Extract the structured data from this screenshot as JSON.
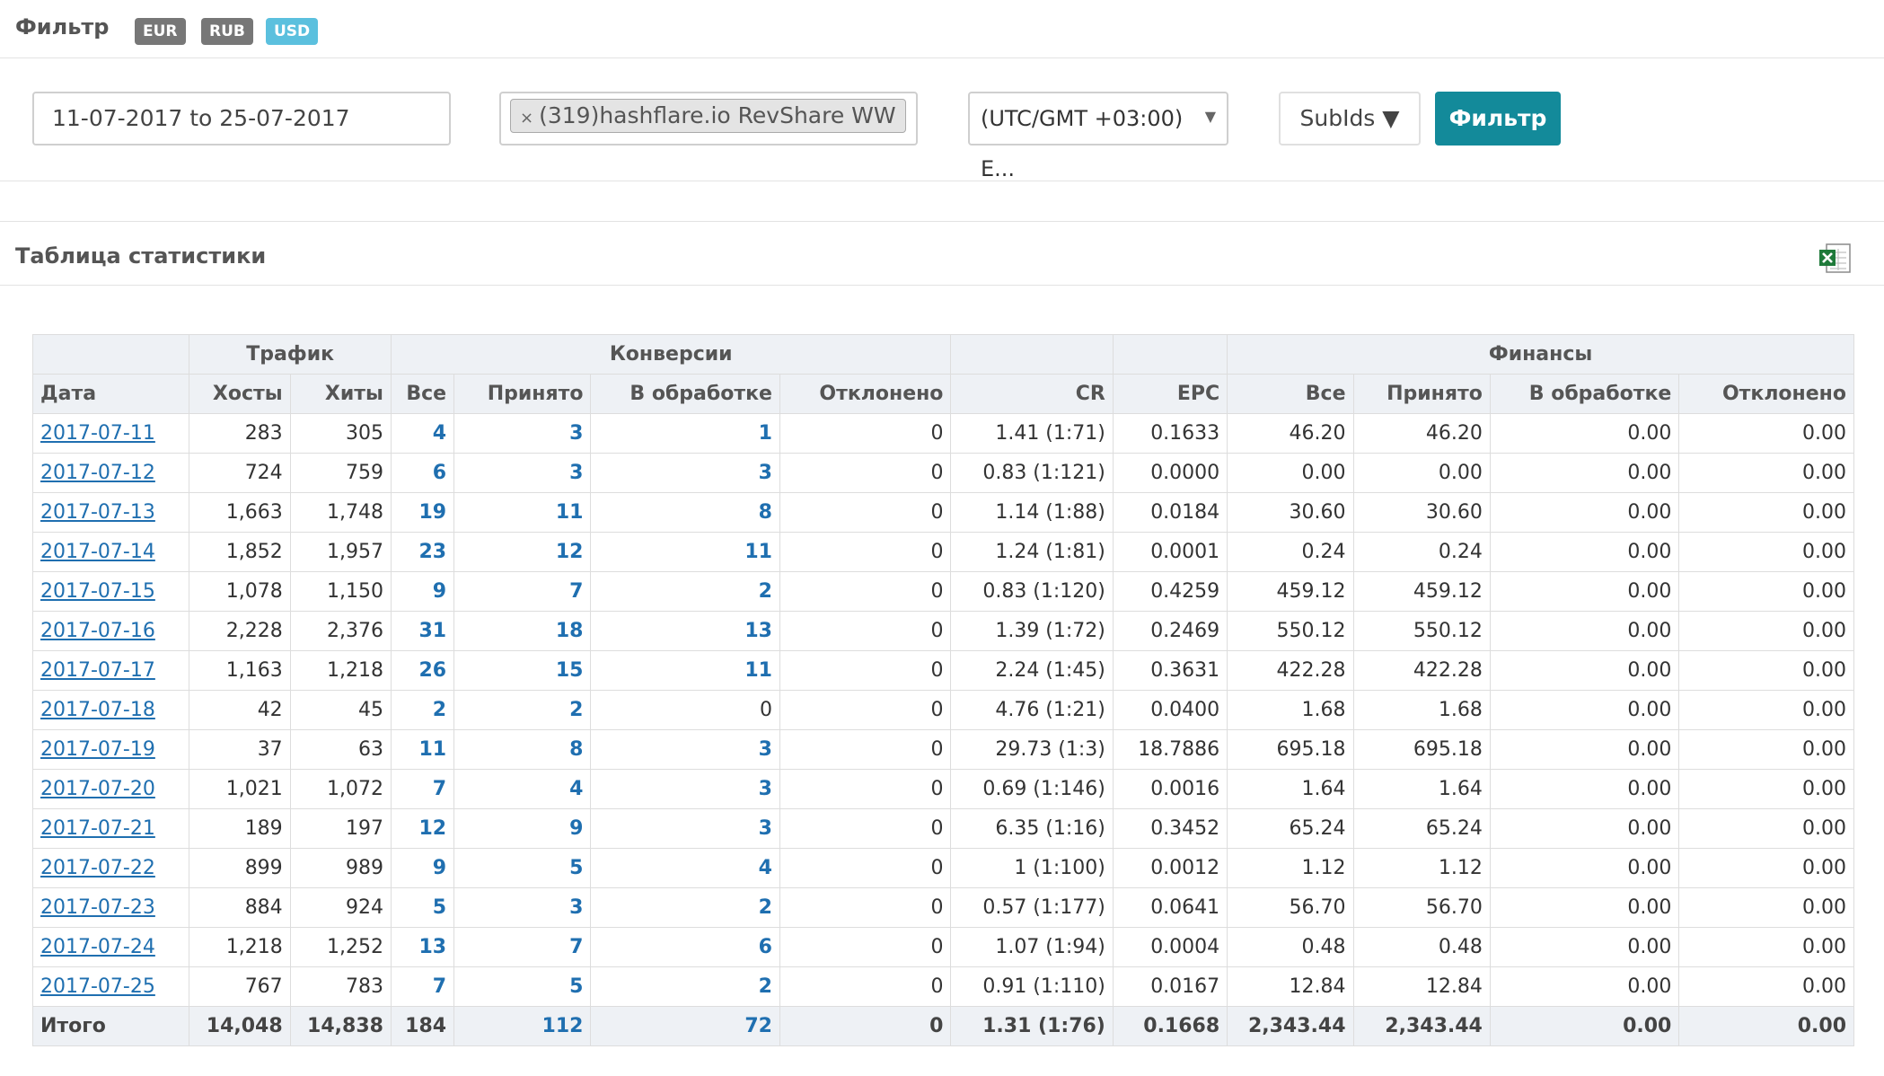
{
  "header": {
    "title": "Фильтр",
    "currencies": [
      "EUR",
      "RUB",
      "USD"
    ],
    "active_currency": "USD"
  },
  "filter": {
    "date_range": "11-07-2017 to 25-07-2017",
    "offer_tag": "(319)hashflare.io RevShare WW",
    "offer_tag_remove": "×",
    "timezone": "(UTC/GMT +03:00) E...",
    "subids_label": "SubIds ▼",
    "filter_button": "Фильтр"
  },
  "stats": {
    "title": "Таблица статистики",
    "export_icon": "excel-icon",
    "groups": {
      "traffic": "Трафик",
      "conversions": "Конверсии",
      "finance": "Финансы"
    },
    "columns": {
      "date": "Дата",
      "hosts": "Хосты",
      "hits": "Хиты",
      "conv_all": "Все",
      "conv_accepted": "Принято",
      "conv_processing": "В обработке",
      "conv_rejected": "Отклонено",
      "cr": "CR",
      "epc": "EPC",
      "fin_all": "Все",
      "fin_accepted": "Принято",
      "fin_processing": "В обработке",
      "fin_rejected": "Отклонено"
    },
    "rows": [
      [
        "2017-07-11",
        "283",
        "305",
        "4",
        "3",
        "1",
        "0",
        "1.41 (1:71)",
        "0.1633",
        "46.20",
        "46.20",
        "0.00",
        "0.00"
      ],
      [
        "2017-07-12",
        "724",
        "759",
        "6",
        "3",
        "3",
        "0",
        "0.83 (1:121)",
        "0.0000",
        "0.00",
        "0.00",
        "0.00",
        "0.00"
      ],
      [
        "2017-07-13",
        "1,663",
        "1,748",
        "19",
        "11",
        "8",
        "0",
        "1.14 (1:88)",
        "0.0184",
        "30.60",
        "30.60",
        "0.00",
        "0.00"
      ],
      [
        "2017-07-14",
        "1,852",
        "1,957",
        "23",
        "12",
        "11",
        "0",
        "1.24 (1:81)",
        "0.0001",
        "0.24",
        "0.24",
        "0.00",
        "0.00"
      ],
      [
        "2017-07-15",
        "1,078",
        "1,150",
        "9",
        "7",
        "2",
        "0",
        "0.83 (1:120)",
        "0.4259",
        "459.12",
        "459.12",
        "0.00",
        "0.00"
      ],
      [
        "2017-07-16",
        "2,228",
        "2,376",
        "31",
        "18",
        "13",
        "0",
        "1.39 (1:72)",
        "0.2469",
        "550.12",
        "550.12",
        "0.00",
        "0.00"
      ],
      [
        "2017-07-17",
        "1,163",
        "1,218",
        "26",
        "15",
        "11",
        "0",
        "2.24 (1:45)",
        "0.3631",
        "422.28",
        "422.28",
        "0.00",
        "0.00"
      ],
      [
        "2017-07-18",
        "42",
        "45",
        "2",
        "2",
        "0",
        "0",
        "4.76 (1:21)",
        "0.0400",
        "1.68",
        "1.68",
        "0.00",
        "0.00"
      ],
      [
        "2017-07-19",
        "37",
        "63",
        "11",
        "8",
        "3",
        "0",
        "29.73 (1:3)",
        "18.7886",
        "695.18",
        "695.18",
        "0.00",
        "0.00"
      ],
      [
        "2017-07-20",
        "1,021",
        "1,072",
        "7",
        "4",
        "3",
        "0",
        "0.69 (1:146)",
        "0.0016",
        "1.64",
        "1.64",
        "0.00",
        "0.00"
      ],
      [
        "2017-07-21",
        "189",
        "197",
        "12",
        "9",
        "3",
        "0",
        "6.35 (1:16)",
        "0.3452",
        "65.24",
        "65.24",
        "0.00",
        "0.00"
      ],
      [
        "2017-07-22",
        "899",
        "989",
        "9",
        "5",
        "4",
        "0",
        "1 (1:100)",
        "0.0012",
        "1.12",
        "1.12",
        "0.00",
        "0.00"
      ],
      [
        "2017-07-23",
        "884",
        "924",
        "5",
        "3",
        "2",
        "0",
        "0.57 (1:177)",
        "0.0641",
        "56.70",
        "56.70",
        "0.00",
        "0.00"
      ],
      [
        "2017-07-24",
        "1,218",
        "1,252",
        "13",
        "7",
        "6",
        "0",
        "1.07 (1:94)",
        "0.0004",
        "0.48",
        "0.48",
        "0.00",
        "0.00"
      ],
      [
        "2017-07-25",
        "767",
        "783",
        "7",
        "5",
        "2",
        "0",
        "0.91 (1:110)",
        "0.0167",
        "12.84",
        "12.84",
        "0.00",
        "0.00"
      ]
    ],
    "total": [
      "Итого",
      "14,048",
      "14,838",
      "184",
      "112",
      "72",
      "0",
      "1.31 (1:76)",
      "0.1668",
      "2,343.44",
      "2,343.44",
      "0.00",
      "0.00"
    ]
  }
}
